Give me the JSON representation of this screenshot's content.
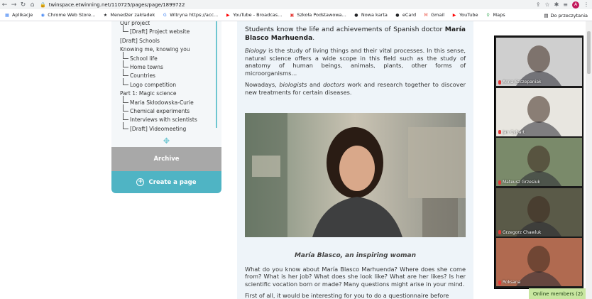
{
  "browser": {
    "url": "twinspace.etwinning.net/110725/pages/page/1899722",
    "bookmarks": [
      {
        "label": "Aplikacje",
        "icon": "apps-grid-icon"
      },
      {
        "label": "Chrome Web Store...",
        "icon": "chrome-store-icon"
      },
      {
        "label": "Menedżer zakładek",
        "icon": "star-icon"
      },
      {
        "label": "Witryna https://acc...",
        "icon": "google-icon"
      },
      {
        "label": "YouTube - Broadcas...",
        "icon": "youtube-icon"
      },
      {
        "label": "Szkoła Podstawowa...",
        "icon": "school-icon"
      },
      {
        "label": "Nowa karta",
        "icon": "globe-icon"
      },
      {
        "label": "eCard",
        "icon": "globe-icon"
      },
      {
        "label": "Gmail",
        "icon": "gmail-icon"
      },
      {
        "label": "YouTube",
        "icon": "youtube-icon"
      },
      {
        "label": "Maps",
        "icon": "maps-pin-icon"
      }
    ],
    "reading_list": "Do przeczytania",
    "profile_initial": "A"
  },
  "sidebar": {
    "tree": [
      {
        "label": "Our project",
        "level": 0
      },
      {
        "label": "[Draft] Project website",
        "level": 1
      },
      {
        "label": "[Draft] Schools",
        "level": 0
      },
      {
        "label": "Knowing me, knowing you",
        "level": 0
      },
      {
        "label": "School life",
        "level": 1
      },
      {
        "label": "Home towns",
        "level": 1
      },
      {
        "label": "Countries",
        "level": 1
      },
      {
        "label": "Logo competition",
        "level": 1
      },
      {
        "label": "Part 1: Magic science",
        "level": 0
      },
      {
        "label": "Maria Skłodowska-Curie",
        "level": 1
      },
      {
        "label": "Chemical experiments",
        "level": 1
      },
      {
        "label": "Interviews with scientists",
        "level": 1
      },
      {
        "label": "[Draft] Videomeeting",
        "level": 1
      }
    ],
    "archive_label": "Archive",
    "create_label": "Create a page"
  },
  "article": {
    "lead_plain": "Students know the life and achievements of Spanish doctor ",
    "lead_bold": "María Blasco Marhuenda",
    "lead_end": ".",
    "p1_em": "Biology",
    "p1_rest": " is the study of living things and their vital processes. In this sense, natural science offers a wide scope in this field such as the study of anatomy of human beings, animals, plants, other forms of microorganisms...",
    "p2_start": "Nowadays, ",
    "p2_em1": "biologists",
    "p2_mid": " and ",
    "p2_em2": "doctors",
    "p2_rest": " work and research together to discover new treatments for certain diseases.",
    "caption": "María Blasco, an inspiring woman",
    "p3": "What do you know about María Blasco Marhuenda? Where does she come from? What is her job? What does she look like? What are her likes? Is her scientific vocation born or made? Many questions might arise in your mind.",
    "p4": "First of all, it would be interesting for you to do a questionnaire before"
  },
  "video_call": {
    "participants": [
      {
        "name": "Anna Szczepaniak",
        "bg": "#cfcfcf"
      },
      {
        "name": "Jan Cybart",
        "bg": "#e8e6e0"
      },
      {
        "name": "Mateusz Grzesiuk",
        "bg": "#7a8a6a"
      },
      {
        "name": "Grzegorz Chawluk",
        "bg": "#5a5a48"
      },
      {
        "name": "Roksana",
        "bg": "#b06a50"
      }
    ],
    "online_label": "Online members (2)"
  }
}
